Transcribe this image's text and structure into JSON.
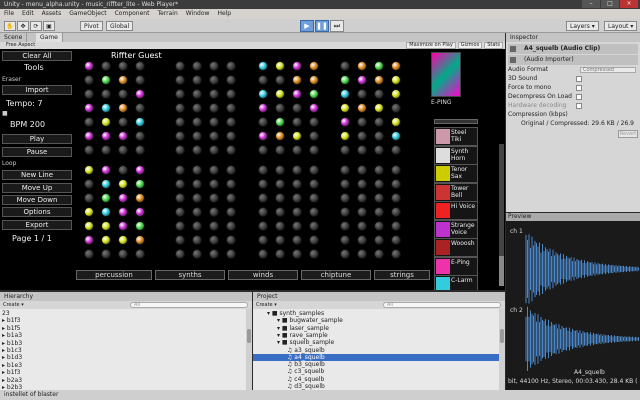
{
  "window": {
    "title": "Unity - menu_alpha.unity - music_riffter_lite - Web Player*"
  },
  "menubar": [
    "File",
    "Edit",
    "Assets",
    "GameObject",
    "Component",
    "Terrain",
    "Window",
    "Help"
  ],
  "toolbar": {
    "pivot": "Pivot",
    "global": "Global",
    "layers": "Layers",
    "layout": "Layout"
  },
  "scene_tabs": [
    "Scene",
    "Game"
  ],
  "game_toolbar": {
    "aspect": "Free Aspect",
    "maximize": "Maximize on Play",
    "gizmos": "Gizmos",
    "stats": "Stats"
  },
  "game": {
    "title": "Riffter Guest",
    "left": {
      "clear_all": "Clear All",
      "tools": "Tools",
      "eraser": "Eraser",
      "import": "Import",
      "tempo": "Tempo: 7",
      "bpm": "BPM 200",
      "play": "Play",
      "pause": "Pause",
      "loop": "Loop",
      "new_line": "New Line",
      "move_up": "Move Up",
      "move_down": "Move Down",
      "options": "Options",
      "export": "Export",
      "page": "Page 1 / 1"
    },
    "categories": [
      "percussion",
      "synths",
      "winds",
      "chiptune",
      "strings"
    ],
    "preset_title": "E-PING",
    "presets": [
      {
        "label": "Steel Tiki",
        "color": "#c9a"
      },
      {
        "label": "Synth Horn",
        "color": "#ddd"
      },
      {
        "label": "Tenor Sax",
        "color": "#cc0"
      },
      {
        "label": "Tower Bell",
        "color": "#c33"
      },
      {
        "label": "Hi Voice",
        "color": "#e22"
      },
      {
        "label": "Strange Voice",
        "color": "#b3c"
      },
      {
        "label": "Wooosh",
        "color": "#a22"
      },
      {
        "label": "E-Ping",
        "color": "#e3a"
      },
      {
        "label": "C-Larm",
        "color": "#3cd"
      }
    ]
  },
  "inspector": {
    "tab": "Inspector",
    "asset_name": "A4_squelb (Audio Clip)",
    "importer": "(Audio Importer)",
    "audio_format_label": "Audio Format",
    "audio_format_value": "Compressed",
    "sound3d": "3D Sound",
    "force_mono": "Force to mono",
    "decompress": "Decompress On Load",
    "hardware": "Hardware decoding",
    "compression_label": "Compression (kbps)",
    "compression_value": "160",
    "original": "Original / Compressed: 29.6 KB / 26.9",
    "revert": "Revert"
  },
  "preview": {
    "title": "Preview",
    "ch1": "ch 1",
    "ch2": "ch 2",
    "name": "A4_squelb",
    "info": "bit, 44100 Hz, Stereo, 00:03.430, 28.4 KB ("
  },
  "hierarchy": {
    "tab": "Hierarchy",
    "create": "Create ▾",
    "search": "All",
    "items": [
      "23",
      "b1f3",
      "b1f5",
      "b1a3",
      "b1b3",
      "b1c3",
      "b1d3",
      "b1e3",
      "b1f3",
      "b2a3",
      "b2b3"
    ]
  },
  "project": {
    "tab": "Project",
    "create": "Create ▾",
    "search": "All",
    "items": [
      {
        "label": "synth_samples",
        "indent": 0,
        "folder": true,
        "selected": false
      },
      {
        "label": "bugwater_sample",
        "indent": 1,
        "folder": true,
        "selected": false
      },
      {
        "label": "laser_sample",
        "indent": 1,
        "folder": true,
        "selected": false
      },
      {
        "label": "rave_sample",
        "indent": 1,
        "folder": true,
        "selected": false
      },
      {
        "label": "squelb_sample",
        "indent": 1,
        "folder": true,
        "selected": false
      },
      {
        "label": "a3_squelb",
        "indent": 2,
        "folder": false,
        "selected": false
      },
      {
        "label": "a4_squelb",
        "indent": 2,
        "folder": false,
        "selected": true
      },
      {
        "label": "b3_squelb",
        "indent": 2,
        "folder": false,
        "selected": false
      },
      {
        "label": "c3_squelb",
        "indent": 2,
        "folder": false,
        "selected": false
      },
      {
        "label": "c4_squelb",
        "indent": 2,
        "folder": false,
        "selected": false
      },
      {
        "label": "d3_squelb",
        "indent": 2,
        "folder": false,
        "selected": false
      },
      {
        "label": "d4_squelb",
        "indent": 2,
        "folder": false,
        "selected": false
      }
    ]
  },
  "status": "instellet of blaster"
}
